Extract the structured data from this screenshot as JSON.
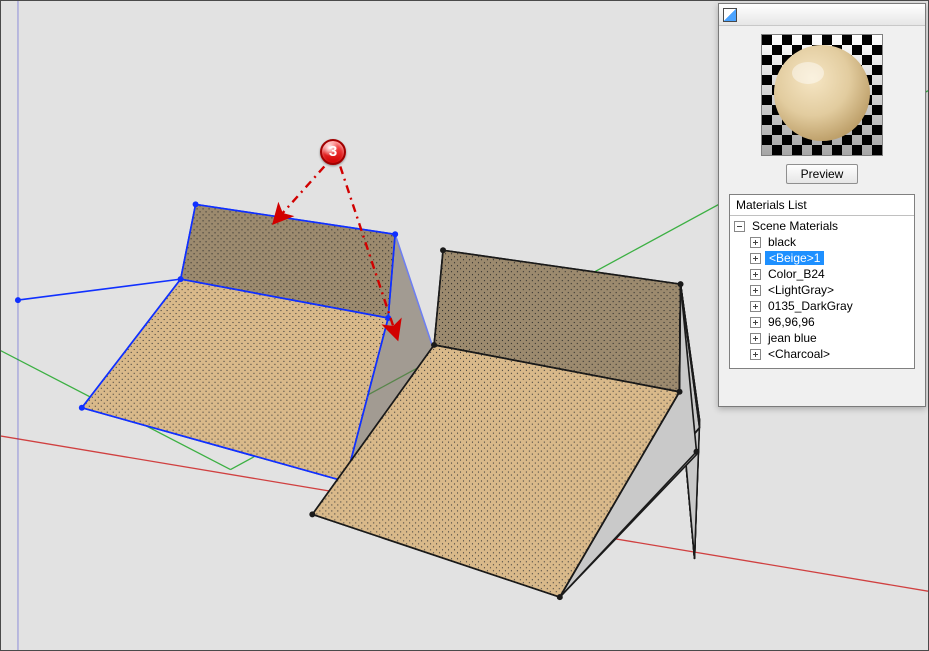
{
  "annotation": {
    "badge_number": "3"
  },
  "panel": {
    "preview_button": "Preview",
    "list_header": "Materials List",
    "root_label": "Scene Materials",
    "items": [
      {
        "label": "black",
        "selected": false
      },
      {
        "label": "<Beige>1",
        "selected": true
      },
      {
        "label": "Color_B24",
        "selected": false
      },
      {
        "label": "<LightGray>",
        "selected": false
      },
      {
        "label": "0135_DarkGray",
        "selected": false
      },
      {
        "label": "96,96,96",
        "selected": false
      },
      {
        "label": "jean blue",
        "selected": false
      },
      {
        "label": "<Charcoal>",
        "selected": false
      }
    ]
  },
  "colors": {
    "viewport_bg": "#e2e2e2",
    "axis_x": "#d04040",
    "axis_y": "#3cb043",
    "axis_z": "#2a2acf",
    "cube_front": "#d9b98a",
    "cube_top_shadow": "#9c8a6e",
    "cube_side_gray": "#c9c9c9",
    "cube_edge_black": "#1a1a1a",
    "cube_edge_blue": "#1030ff",
    "texture_dot": "#3a3a3a",
    "selection": "#1e90ff",
    "annotation_red": "#d10000"
  }
}
